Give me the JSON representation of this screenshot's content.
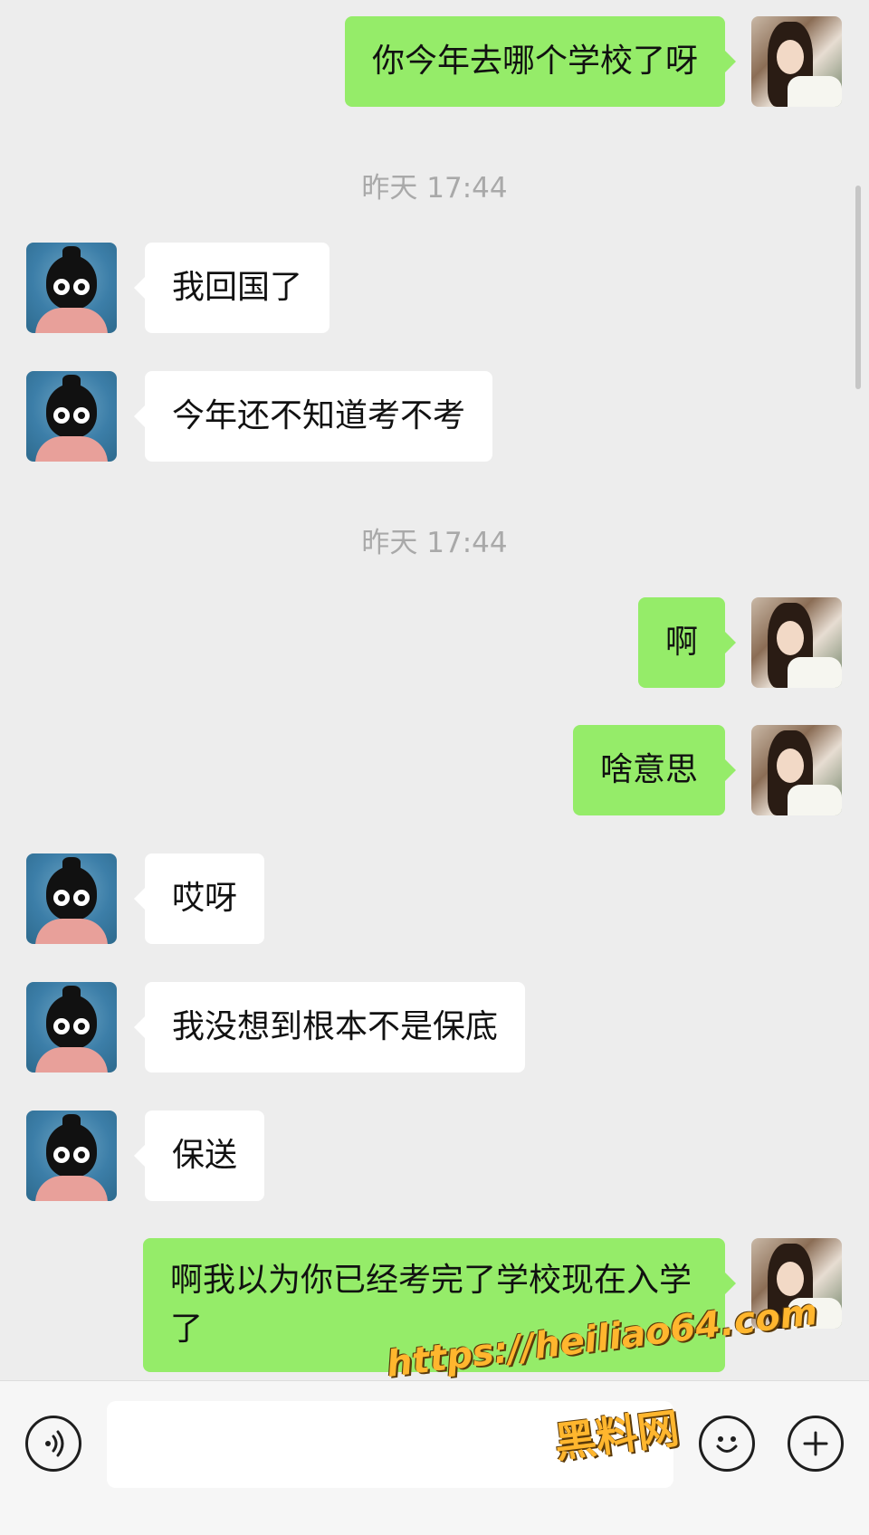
{
  "messages": [
    {
      "side": "self",
      "text": "你今年去哪个学校了呀"
    },
    {
      "timestamp": "昨天 17:44"
    },
    {
      "side": "other",
      "text": "我回国了"
    },
    {
      "side": "other",
      "text": "今年还不知道考不考"
    },
    {
      "timestamp": "昨天 17:44"
    },
    {
      "side": "self",
      "text": "啊"
    },
    {
      "side": "self",
      "text": "啥意思"
    },
    {
      "side": "other",
      "text": "哎呀"
    },
    {
      "side": "other",
      "text": "我没想到根本不是保底"
    },
    {
      "side": "other",
      "text": "保送"
    },
    {
      "side": "self",
      "text": "啊我以为你已经考完了学校现在入学了"
    }
  ],
  "input_bar": {
    "voice_icon": "voice-icon",
    "emoji_icon": "emoji-icon",
    "plus_icon": "plus-icon",
    "input_value": ""
  },
  "watermark": {
    "url": "https://heiliao64.com",
    "name": "黑料网",
    "color": "#ffb62e"
  },
  "colors": {
    "self_bubble": "#95ec69",
    "other_bubble": "#ffffff",
    "background": "#ededed"
  }
}
